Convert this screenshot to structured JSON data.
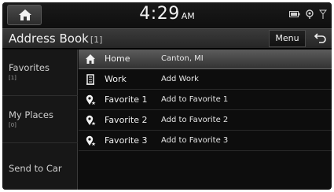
{
  "status": {
    "time": "4:29",
    "ampm": "AM",
    "icons": [
      "home-icon",
      "battery-icon",
      "location-icon",
      "signal-icon"
    ]
  },
  "header": {
    "title": "Address Book",
    "count": "[1]",
    "menu_label": "Menu",
    "back_icon": "back-arrow-icon"
  },
  "sidebar": {
    "items": [
      {
        "label": "Favorites",
        "sub": "[1]"
      },
      {
        "label": "My Places",
        "sub": "[0]"
      },
      {
        "label": "Send to Car",
        "sub": ""
      }
    ]
  },
  "list": {
    "rows": [
      {
        "name": "Home",
        "value": "Canton, MI",
        "icon": "home-icon",
        "selected": true
      },
      {
        "name": "Work",
        "value": "Add Work",
        "icon": "building-icon",
        "selected": false
      },
      {
        "name": "Favorite 1",
        "value": "Add to Favorite 1",
        "icon": "favorite-pin-icon",
        "selected": false
      },
      {
        "name": "Favorite 2",
        "value": "Add to Favorite 2",
        "icon": "favorite-pin-icon",
        "selected": false
      },
      {
        "name": "Favorite 3",
        "value": "Add to Favorite 3",
        "icon": "favorite-pin-icon",
        "selected": false
      }
    ]
  },
  "colors": {
    "background": "#0d0d0d",
    "text": "#f0f0f0",
    "selected_row": "#5c5c5c"
  }
}
